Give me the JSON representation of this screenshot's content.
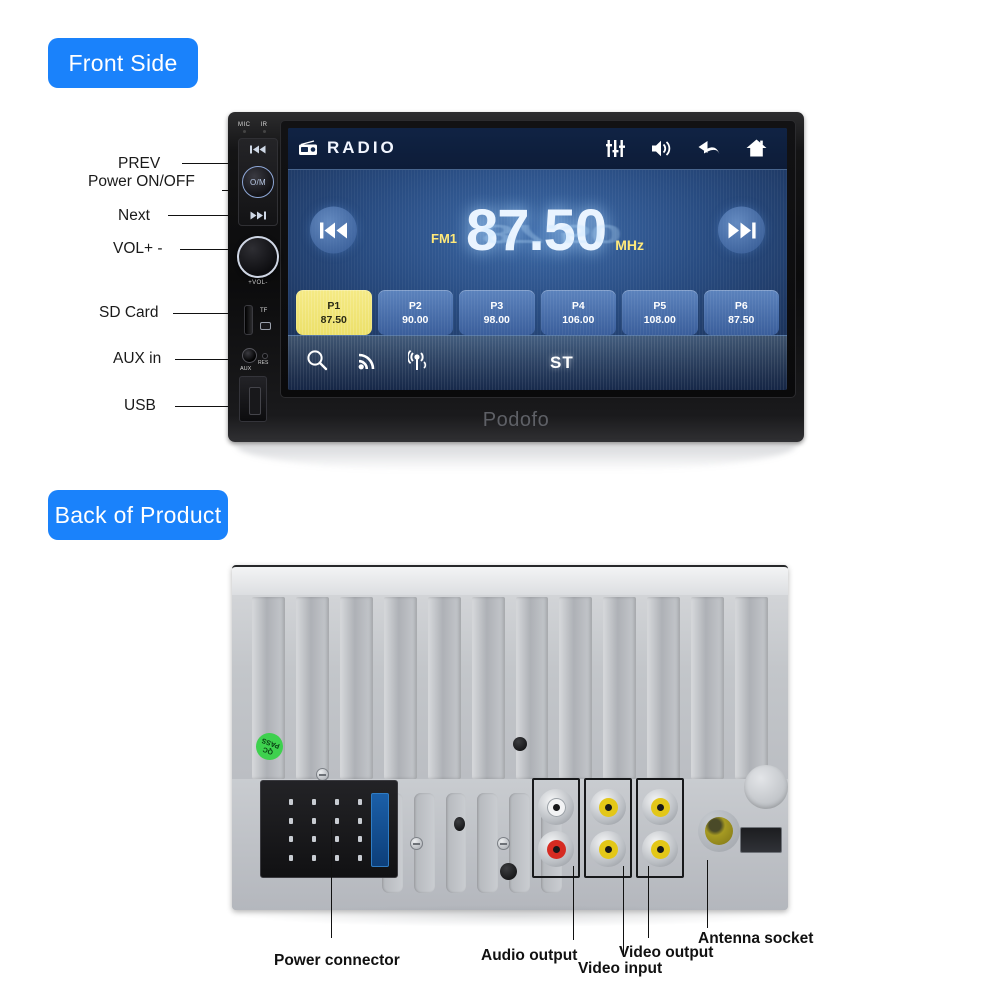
{
  "sections": {
    "front_badge": "Front Side",
    "back_badge": "Back of Product"
  },
  "front": {
    "brand": "Podofo",
    "panel_marks": {
      "mic": "MIC",
      "ir": "IR",
      "power": "O/M",
      "vol": "+VOL-",
      "tf": "TF",
      "aux": "AUX",
      "res": "RES"
    },
    "callouts": [
      {
        "label": "PREV",
        "icon": "prev-track-icon"
      },
      {
        "label": "Power ON/OFF",
        "icon": "power-button-icon"
      },
      {
        "label": "Next",
        "icon": "next-track-icon"
      },
      {
        "label": "VOL+ -",
        "icon": "volume-knob-icon"
      },
      {
        "label": "SD Card",
        "icon": "sd-card-slot-icon"
      },
      {
        "label": "AUX in",
        "icon": "aux-jack-icon"
      },
      {
        "label": "USB",
        "icon": "usb-port-icon"
      }
    ],
    "screen": {
      "topbar": {
        "source_icon": "radio-icon",
        "title": "RADIO",
        "icons": [
          "equalizer-icon",
          "volume-icon",
          "back-arrow-icon",
          "home-icon"
        ]
      },
      "tuner": {
        "band": "FM1",
        "frequency": "87.50",
        "unit": "MHz",
        "prev_icon": "prev-track-icon",
        "next_icon": "next-track-icon"
      },
      "presets": [
        {
          "name": "P1",
          "freq": "87.50",
          "active": true
        },
        {
          "name": "P2",
          "freq": "90.00",
          "active": false
        },
        {
          "name": "P3",
          "freq": "98.00",
          "active": false
        },
        {
          "name": "P4",
          "freq": "106.00",
          "active": false
        },
        {
          "name": "P5",
          "freq": "108.00",
          "active": false
        },
        {
          "name": "P6",
          "freq": "87.50",
          "active": false
        }
      ],
      "bottombar": {
        "icons": [
          "search-icon",
          "signal-icon",
          "radio-wave-icon"
        ],
        "stereo_label": "ST"
      },
      "colors": {
        "accent_yellow": "#ece06a",
        "screen_blue": "#3a5e9b",
        "topbar_blue": "#102344"
      }
    }
  },
  "back": {
    "qc_sticker": "QC PASS",
    "callouts": [
      {
        "label": "Power connector"
      },
      {
        "label": "Audio output"
      },
      {
        "label": "Video input"
      },
      {
        "label": "Video output"
      },
      {
        "label": "Antenna socket"
      }
    ]
  }
}
